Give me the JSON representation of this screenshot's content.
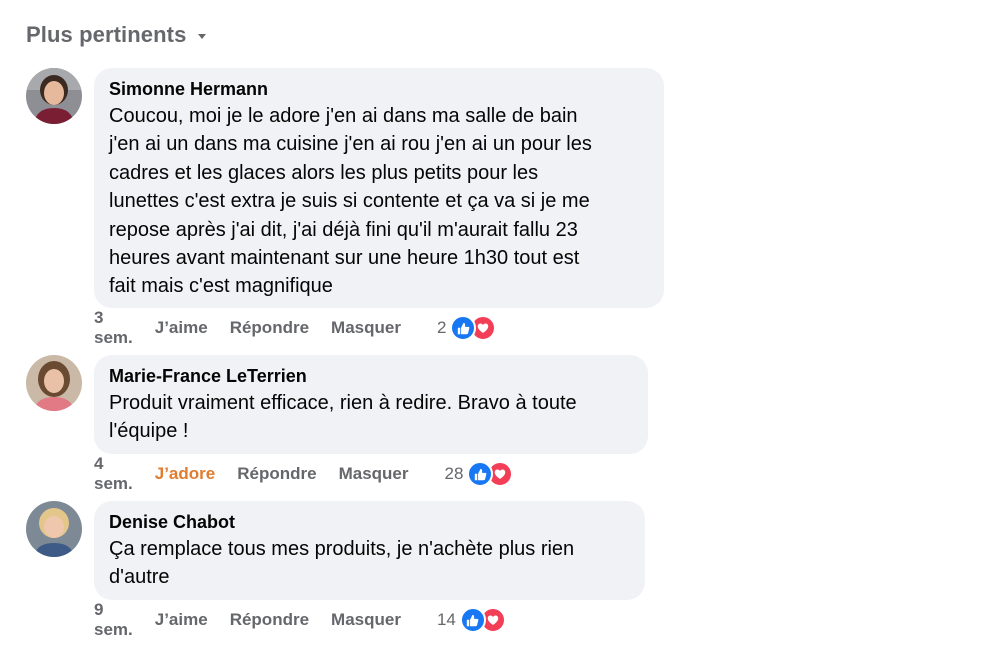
{
  "sort": {
    "label": "Plus pertinents"
  },
  "colors": {
    "bubble_bg": "#f0f2f5",
    "secondary_text": "#65676b",
    "like_blue": "#1877f2",
    "love_red": "#f33e58",
    "adore_orange": "#e07c2f"
  },
  "comments": [
    {
      "author": "Simonne Hermann",
      "text": "Coucou, moi je le adore j'en ai dans ma salle de bain\nj'en ai un dans ma cuisine j'en ai rou j'en ai un pour les\ncadres et les glaces alors les plus petits pour les\nlunettes c'est extra je suis si contente et ça va si je me\nrepose après j'ai dit, j'ai déjà fini qu'il m'aurait fallu 23\nheures avant maintenant sur une heure 1h30 tout est\nfait mais c'est magnifique",
      "time": "3 sem.",
      "react_label": "J’aime",
      "reply_label": "Répondre",
      "hide_label": "Masquer",
      "reaction_count": "2",
      "reactions": [
        "like-icon",
        "love-icon"
      ]
    },
    {
      "author": "Marie-France LeTerrien",
      "text": "Produit vraiment efficace, rien à redire. Bravo à toute\nl'équipe !",
      "time": "4 sem.",
      "react_label": "J’adore",
      "reply_label": "Répondre",
      "hide_label": "Masquer",
      "reaction_count": "28",
      "reactions": [
        "like-icon",
        "love-icon"
      ]
    },
    {
      "author": "Denise Chabot",
      "text": "Ça remplace tous mes produits, je n'achète plus rien\nd'autre",
      "time": "9 sem.",
      "react_label": "J’aime",
      "reply_label": "Répondre",
      "hide_label": "Masquer",
      "reaction_count": "14",
      "reactions": [
        "like-icon",
        "love-icon"
      ]
    }
  ]
}
